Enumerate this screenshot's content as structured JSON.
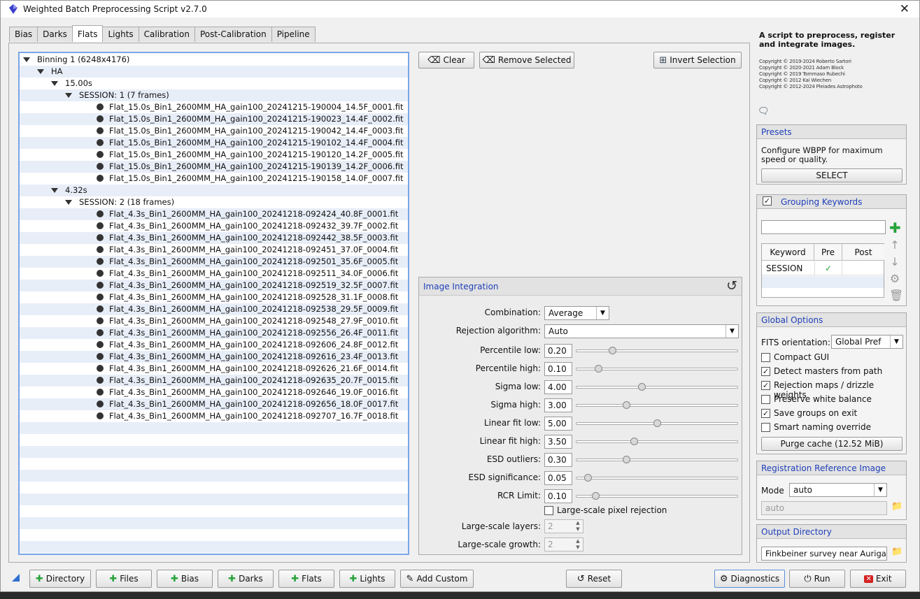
{
  "window": {
    "title": "Weighted Batch Preprocessing Script v2.7.0",
    "close_glyph": "✕"
  },
  "tabs": [
    "Bias",
    "Darks",
    "Flats",
    "Lights",
    "Calibration",
    "Post-Calibration",
    "Pipeline"
  ],
  "active_tab": "Flats",
  "tree": {
    "binning": "Binning 1 (6248x4176)",
    "filter": "HA",
    "groups": [
      {
        "exposure": "15.00s",
        "session": "SESSION: 1 (7 frames)",
        "files": [
          "Flat_15.0s_Bin1_2600MM_HA_gain100_20241215-190004_14.5F_0001.fit",
          "Flat_15.0s_Bin1_2600MM_HA_gain100_20241215-190023_14.4F_0002.fit",
          "Flat_15.0s_Bin1_2600MM_HA_gain100_20241215-190042_14.4F_0003.fit",
          "Flat_15.0s_Bin1_2600MM_HA_gain100_20241215-190102_14.4F_0004.fit",
          "Flat_15.0s_Bin1_2600MM_HA_gain100_20241215-190120_14.2F_0005.fit",
          "Flat_15.0s_Bin1_2600MM_HA_gain100_20241215-190139_14.2F_0006.fit",
          "Flat_15.0s_Bin1_2600MM_HA_gain100_20241215-190158_14.0F_0007.fit"
        ]
      },
      {
        "exposure": "4.32s",
        "session": "SESSION: 2 (18 frames)",
        "files": [
          "Flat_4.3s_Bin1_2600MM_HA_gain100_20241218-092424_40.8F_0001.fit",
          "Flat_4.3s_Bin1_2600MM_HA_gain100_20241218-092432_39.7F_0002.fit",
          "Flat_4.3s_Bin1_2600MM_HA_gain100_20241218-092442_38.5F_0003.fit",
          "Flat_4.3s_Bin1_2600MM_HA_gain100_20241218-092451_37.0F_0004.fit",
          "Flat_4.3s_Bin1_2600MM_HA_gain100_20241218-092501_35.6F_0005.fit",
          "Flat_4.3s_Bin1_2600MM_HA_gain100_20241218-092511_34.0F_0006.fit",
          "Flat_4.3s_Bin1_2600MM_HA_gain100_20241218-092519_32.5F_0007.fit",
          "Flat_4.3s_Bin1_2600MM_HA_gain100_20241218-092528_31.1F_0008.fit",
          "Flat_4.3s_Bin1_2600MM_HA_gain100_20241218-092538_29.5F_0009.fit",
          "Flat_4.3s_Bin1_2600MM_HA_gain100_20241218-092548_27.9F_0010.fit",
          "Flat_4.3s_Bin1_2600MM_HA_gain100_20241218-092556_26.4F_0011.fit",
          "Flat_4.3s_Bin1_2600MM_HA_gain100_20241218-092606_24.8F_0012.fit",
          "Flat_4.3s_Bin1_2600MM_HA_gain100_20241218-092616_23.4F_0013.fit",
          "Flat_4.3s_Bin1_2600MM_HA_gain100_20241218-092626_21.6F_0014.fit",
          "Flat_4.3s_Bin1_2600MM_HA_gain100_20241218-092635_20.7F_0015.fit",
          "Flat_4.3s_Bin1_2600MM_HA_gain100_20241218-092646_19.0F_0016.fit",
          "Flat_4.3s_Bin1_2600MM_HA_gain100_20241218-092656_18.0F_0017.fit",
          "Flat_4.3s_Bin1_2600MM_HA_gain100_20241218-092707_16.7F_0018.fit"
        ]
      }
    ]
  },
  "actions": {
    "clear": "Clear",
    "remove_selected": "Remove Selected",
    "invert_selection": "Invert Selection"
  },
  "integration": {
    "title": "Image Integration",
    "combination_label": "Combination:",
    "combination_value": "Average",
    "rejection_label": "Rejection algorithm:",
    "rejection_value": "Auto",
    "params": [
      {
        "label": "Percentile low:",
        "value": "0.20",
        "slider": 0.21
      },
      {
        "label": "Percentile high:",
        "value": "0.10",
        "slider": 0.12
      },
      {
        "label": "Sigma low:",
        "value": "4.00",
        "slider": 0.4
      },
      {
        "label": "Sigma high:",
        "value": "3.00",
        "slider": 0.3
      },
      {
        "label": "Linear fit low:",
        "value": "5.00",
        "slider": 0.5
      },
      {
        "label": "Linear fit high:",
        "value": "3.50",
        "slider": 0.35
      },
      {
        "label": "ESD outliers:",
        "value": "0.30",
        "slider": 0.3
      },
      {
        "label": "ESD significance:",
        "value": "0.05",
        "slider": 0.05
      },
      {
        "label": "RCR Limit:",
        "value": "0.10",
        "slider": 0.1
      }
    ],
    "large_scale_label": "Large-scale pixel rejection",
    "layers_label": "Large-scale layers:",
    "layers_value": "2",
    "growth_label": "Large-scale growth:",
    "growth_value": "2"
  },
  "right": {
    "description": "A script to preprocess, register and integrate images.",
    "copyright": [
      "Copyright © 2019-2024 Roberto Sartori",
      "Copyright © 2020-2021 Adam Block",
      "Copyright © 2019 Tommaso Rubechi",
      "Copyright © 2012 Kai Wiechen",
      "Copyright © 2012-2024 Pleiades Astrophoto"
    ],
    "presets_title": "Presets",
    "presets_text": "Configure WBPP for maximum speed or quality.",
    "presets_button": "SELECT",
    "grouping_title": "Grouping Keywords",
    "kw_headers": [
      "Keyword",
      "Pre",
      "Post"
    ],
    "kw_row": "SESSION",
    "global_title": "Global Options",
    "fits_label": "FITS orientation:",
    "fits_value": "Global Pref",
    "options": [
      {
        "label": "Compact GUI",
        "checked": false
      },
      {
        "label": "Detect masters from path",
        "checked": true
      },
      {
        "label": "Rejection maps / drizzle weights",
        "checked": true
      },
      {
        "label": "Preserve white balance",
        "checked": false
      },
      {
        "label": "Save groups on exit",
        "checked": true
      },
      {
        "label": "Smart naming override",
        "checked": false
      }
    ],
    "purge_button": "Purge cache (12.52 MiB)",
    "reg_title": "Registration Reference Image",
    "mode_label": "Mode",
    "mode_value": "auto",
    "auto_field": "auto",
    "output_title": "Output Directory",
    "output_value": "Finkbeiner survey near Auriga"
  },
  "bottom_buttons": {
    "directory": "Directory",
    "files": "Files",
    "bias": "Bias",
    "darks": "Darks",
    "flats": "Flats",
    "lights": "Lights",
    "add_custom": "Add Custom",
    "reset": "Reset",
    "diagnostics": "Diagnostics",
    "run": "Run",
    "exit": "Exit"
  },
  "colors": {
    "accent_blue": "#1f3fb8",
    "tree_border": "#7aa5e8",
    "add_green": "#27a33a",
    "exit_red": "#d32020"
  }
}
